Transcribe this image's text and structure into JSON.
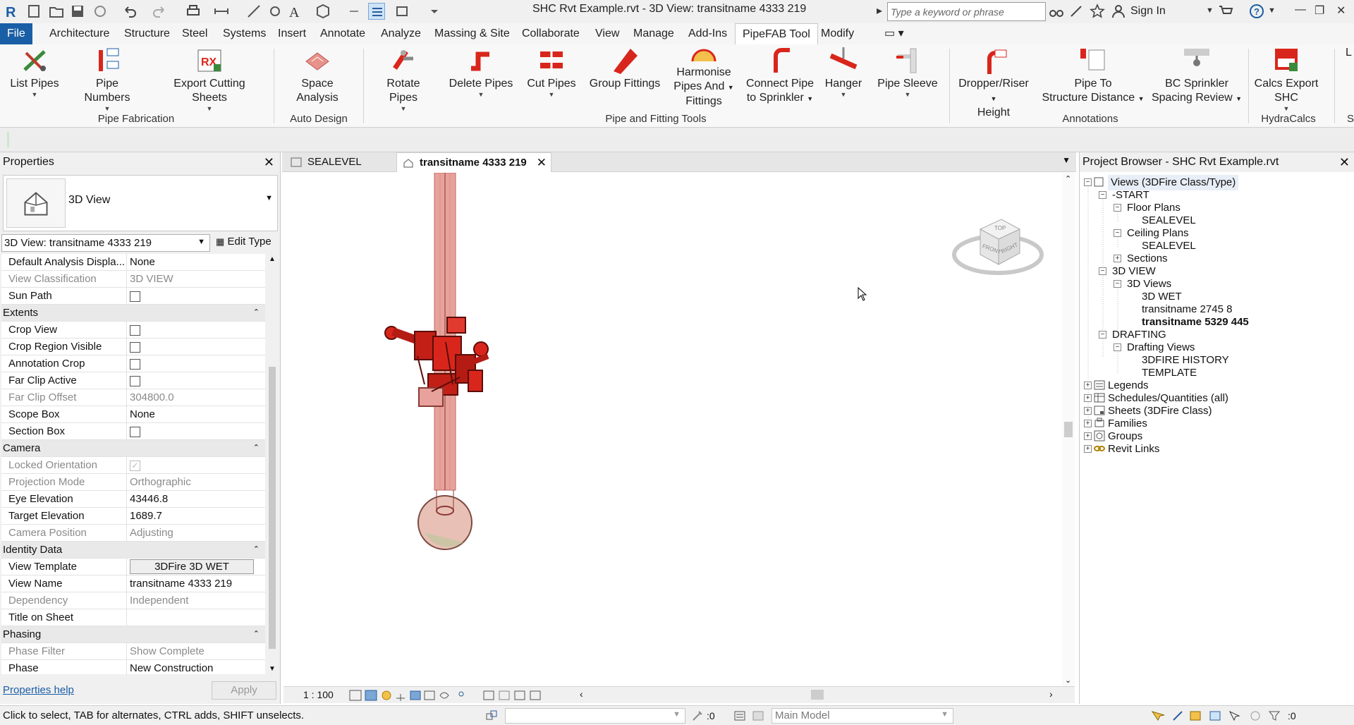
{
  "titlebar": {
    "title": "SHC Rvt Example.rvt - 3D View: transitname 4333 219",
    "search_placeholder": "Type a keyword or phrase",
    "signin": "Sign In"
  },
  "menu": [
    {
      "label": "File"
    },
    {
      "label": "Architecture"
    },
    {
      "label": "Structure"
    },
    {
      "label": "Steel"
    },
    {
      "label": "Systems"
    },
    {
      "label": "Insert"
    },
    {
      "label": "Annotate"
    },
    {
      "label": "Analyze"
    },
    {
      "label": "Massing & Site"
    },
    {
      "label": "Collaborate"
    },
    {
      "label": "View"
    },
    {
      "label": "Manage"
    },
    {
      "label": "Add-Ins"
    },
    {
      "label": "PipeFAB Tool"
    },
    {
      "label": "Modify"
    }
  ],
  "ribbon": {
    "buttons": [
      {
        "line1": "List Pipes",
        "line2": "",
        "line3": ""
      },
      {
        "line1": "Pipe Numbers",
        "line2": "",
        "line3": ""
      },
      {
        "line1": "Export Cutting Sheets",
        "line2": "",
        "line3": ""
      },
      {
        "line1": "Space Analysis",
        "line2": "",
        "line3": ""
      },
      {
        "line1": "Rotate Pipes",
        "line2": "",
        "line3": ""
      },
      {
        "line1": "Delete Pipes",
        "line2": "",
        "line3": ""
      },
      {
        "line1": "Cut Pipes",
        "line2": "",
        "line3": ""
      },
      {
        "line1": "Group Fittings",
        "line2": "",
        "line3": ""
      },
      {
        "line1": "Harmonise",
        "line2": "Pipes And",
        "line3": "Fittings"
      },
      {
        "line1": "Connect Pipe",
        "line2": "to Sprinkler",
        "line3": ""
      },
      {
        "line1": "Hanger",
        "line2": "",
        "line3": ""
      },
      {
        "line1": "Pipe Sleeve",
        "line2": "",
        "line3": ""
      },
      {
        "line1": "Dropper/Riser",
        "line2": "Height",
        "line3": ""
      },
      {
        "line1": "Pipe To",
        "line2": "Structure Distance",
        "line3": ""
      },
      {
        "line1": "BC Sprinkler",
        "line2": "Spacing Review",
        "line3": ""
      },
      {
        "line1": "Calcs Export SHC",
        "line2": "",
        "line3": ""
      }
    ],
    "panels": [
      "Pipe Fabrication",
      "Auto Design",
      "Pipe and Fitting Tools",
      "Annotations",
      "HydraCalcs"
    ]
  },
  "properties": {
    "title": "Properties",
    "type_name": "3D View",
    "instance": "3D View: transitname 4333 219",
    "edit_type": "Edit Type",
    "rows": [
      {
        "name": "Default Analysis Displa...",
        "value": "None"
      },
      {
        "name": "View Classification",
        "value": "3D VIEW"
      },
      {
        "name": "Sun Path",
        "value": ""
      },
      {
        "group": "Extents"
      },
      {
        "name": "Crop View",
        "value": ""
      },
      {
        "name": "Crop Region Visible",
        "value": ""
      },
      {
        "name": "Annotation Crop",
        "value": ""
      },
      {
        "name": "Far Clip Active",
        "value": ""
      },
      {
        "name": "Far Clip Offset",
        "value": "304800.0"
      },
      {
        "name": "Scope Box",
        "value": "None"
      },
      {
        "name": "Section Box",
        "value": ""
      },
      {
        "group": "Camera"
      },
      {
        "name": "Locked Orientation",
        "value": ""
      },
      {
        "name": "Projection Mode",
        "value": "Orthographic"
      },
      {
        "name": "Eye Elevation",
        "value": "43446.8"
      },
      {
        "name": "Target Elevation",
        "value": "1689.7"
      },
      {
        "name": "Camera Position",
        "value": "Adjusting"
      },
      {
        "group": "Identity Data"
      },
      {
        "name": "View Template",
        "value": "3DFire 3D WET"
      },
      {
        "name": "View Name",
        "value": "transitname 4333 219"
      },
      {
        "name": "Dependency",
        "value": "Independent"
      },
      {
        "name": "Title on Sheet",
        "value": ""
      },
      {
        "group": "Phasing"
      },
      {
        "name": "Phase Filter",
        "value": "Show Complete"
      },
      {
        "name": "Phase",
        "value": "New Construction"
      }
    ],
    "help": "Properties help",
    "apply": "Apply"
  },
  "view": {
    "tabs": [
      "SEALEVEL",
      "transitname 4333 219"
    ],
    "scale": "1 : 100",
    "viewcube_top": "TOP",
    "viewcube_front": "FRONT",
    "viewcube_right": "RIGHT"
  },
  "browser": {
    "title": "Project Browser - SHC Rvt Example.rvt",
    "nodes": [
      "Views (3DFire Class/Type)",
      "-START",
      "Floor Plans",
      "SEALEVEL",
      "Ceiling Plans",
      "SEALEVEL",
      "Sections",
      "3D VIEW",
      "3D Views",
      "3D WET",
      "transitname 2745 8",
      "transitname 5329 445",
      "DRAFTING",
      "Drafting Views",
      "3DFIRE HISTORY",
      "TEMPLATE",
      "Legends",
      "Schedules/Quantities (all)",
      "Sheets (3DFire Class)",
      "Families",
      "Groups",
      "Revit Links"
    ]
  },
  "status": {
    "text": "Click to select, TAB for alternates, CTRL adds, SHIFT unselects.",
    "sel_count": ":0",
    "model": "Main Model",
    "filter_count": ":0"
  },
  "colors": {
    "file_tab": "#1a5ea6",
    "pipe_red": "#d9261c",
    "pipe_pink": "#e8a29b"
  }
}
